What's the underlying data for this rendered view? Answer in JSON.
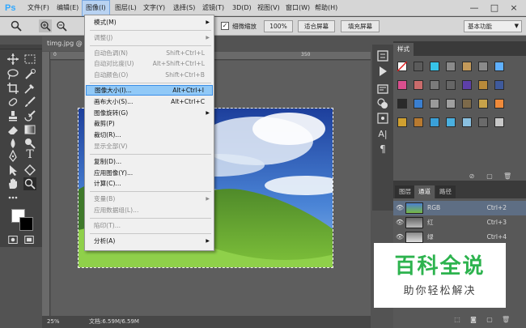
{
  "app": {
    "logo": "Ps",
    "menus": [
      "文件(F)",
      "编辑(E)",
      "图像(I)",
      "图层(L)",
      "文字(Y)",
      "选择(S)",
      "滤镜(T)",
      "3D(D)",
      "视图(V)",
      "窗口(W)",
      "帮助(H)"
    ],
    "active_menu": "图像(I)",
    "window_controls": [
      "—",
      "□",
      "×"
    ]
  },
  "options_bar": {
    "checkbox_label": "细微缩放",
    "checked": true,
    "buttons": [
      "100%",
      "适合屏幕",
      "填充屏幕"
    ],
    "workspace": "基本功能"
  },
  "document": {
    "tab_title": "timg.jpg @",
    "ruler_top_ticks": [
      "0",
      "350"
    ],
    "zoom": "25%",
    "doc_info": "文档:6.59M/6.59M"
  },
  "image_menu": {
    "items": [
      {
        "label": "模式(M)",
        "shortcut": "",
        "submenu": true,
        "disabled": false
      },
      {
        "separator": true
      },
      {
        "label": "调整(J)",
        "shortcut": "",
        "submenu": true,
        "disabled": true
      },
      {
        "separator": true
      },
      {
        "label": "自动色调(N)",
        "shortcut": "Shift+Ctrl+L",
        "submenu": false,
        "disabled": true
      },
      {
        "label": "自动对比度(U)",
        "shortcut": "Alt+Shift+Ctrl+L",
        "submenu": false,
        "disabled": true
      },
      {
        "label": "自动颜色(O)",
        "shortcut": "Shift+Ctrl+B",
        "submenu": false,
        "disabled": true
      },
      {
        "separator": true
      },
      {
        "label": "图像大小(I)...",
        "shortcut": "Alt+Ctrl+I",
        "submenu": false,
        "disabled": false,
        "highlighted": true
      },
      {
        "label": "画布大小(S)...",
        "shortcut": "Alt+Ctrl+C",
        "submenu": false,
        "disabled": false
      },
      {
        "label": "图像旋转(G)",
        "shortcut": "",
        "submenu": true,
        "disabled": false
      },
      {
        "label": "裁剪(P)",
        "shortcut": "",
        "submenu": false,
        "disabled": false
      },
      {
        "label": "裁切(R)...",
        "shortcut": "",
        "submenu": false,
        "disabled": false
      },
      {
        "label": "显示全部(V)",
        "shortcut": "",
        "submenu": false,
        "disabled": true
      },
      {
        "separator": true
      },
      {
        "label": "复制(D)...",
        "shortcut": "",
        "submenu": false,
        "disabled": false
      },
      {
        "label": "应用图像(Y)...",
        "shortcut": "",
        "submenu": false,
        "disabled": false
      },
      {
        "label": "计算(C)...",
        "shortcut": "",
        "submenu": false,
        "disabled": false
      },
      {
        "separator": true
      },
      {
        "label": "变量(B)",
        "shortcut": "",
        "submenu": true,
        "disabled": true
      },
      {
        "label": "应用数据组(L)...",
        "shortcut": "",
        "submenu": false,
        "disabled": true
      },
      {
        "separator": true
      },
      {
        "label": "陷印(T)...",
        "shortcut": "",
        "submenu": false,
        "disabled": true
      },
      {
        "separator": true
      },
      {
        "label": "分析(A)",
        "shortcut": "",
        "submenu": true,
        "disabled": false
      }
    ]
  },
  "styles_panel": {
    "tab": "样式",
    "swatch_colors": [
      [
        "#ffffff",
        "#5b5b5b",
        "#37c4e8",
        "#8a8a8a",
        "#c49a5a",
        "#8a8a8a",
        "#5fb0ff"
      ],
      [
        "#d94f8e",
        "#c96b6b",
        "#7a7a7a",
        "#666666",
        "#5d3fa8",
        "#b88a3a",
        "#3f5a9c"
      ],
      [
        "#2a2a2a",
        "#3a7fd0",
        "#9a9a9a",
        "#a0a0a0",
        "#7d6a4a",
        "#c7a24a",
        "#f08a3a"
      ],
      [
        "#d0a030",
        "#b87a30",
        "#3aa0d8",
        "#4ab0e0",
        "#8ac0e0",
        "#6a6a6a",
        "#c8c8c8"
      ]
    ]
  },
  "channels_panel": {
    "tabs": [
      "图层",
      "通道",
      "路径"
    ],
    "active_tab": "通道",
    "rows": [
      {
        "name": "RGB",
        "shortcut": "Ctrl+2"
      },
      {
        "name": "红",
        "shortcut": "Ctrl+3"
      },
      {
        "name": "绿",
        "shortcut": "Ctrl+4"
      }
    ]
  },
  "watermark": {
    "title": "百科全说",
    "subtitle": "助你轻松解决"
  }
}
